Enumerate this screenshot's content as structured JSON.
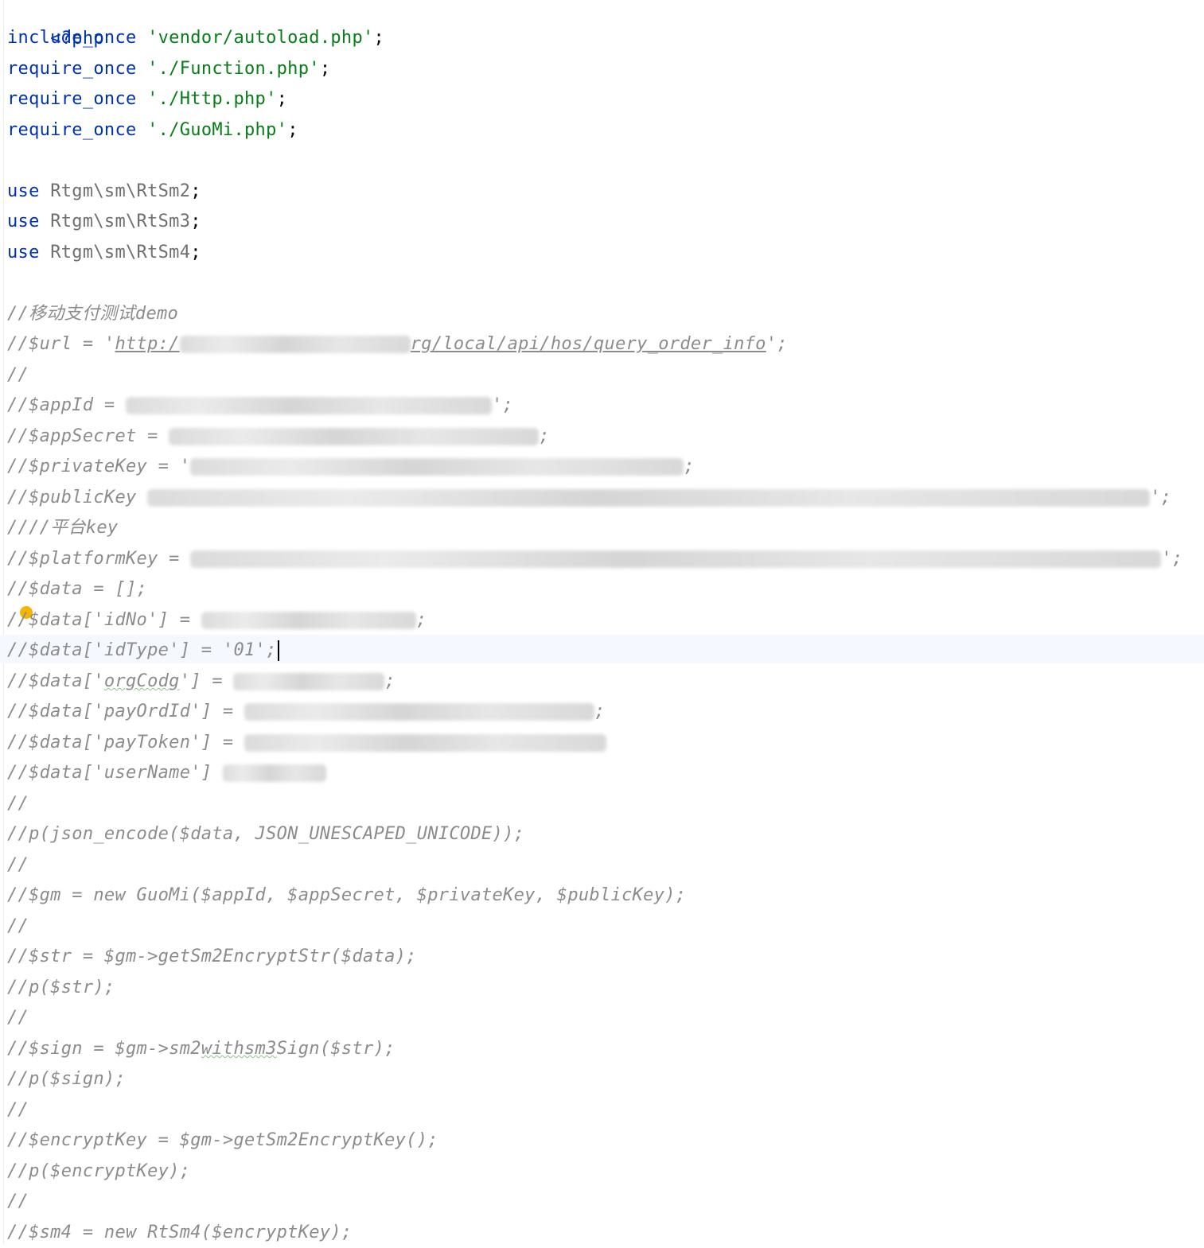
{
  "php_open": "<?php",
  "includes": [
    {
      "keyword": "include_once",
      "path": "'vendor/autoload.php'",
      "end": ";"
    },
    {
      "keyword": "require_once",
      "path": "'./Function.php'",
      "end": ";"
    },
    {
      "keyword": "require_once",
      "path": "'./Http.php'",
      "end": ";"
    },
    {
      "keyword": "require_once",
      "path": "'./GuoMi.php'",
      "end": ";"
    }
  ],
  "uses": [
    {
      "keyword": "use",
      "ns": "Rtgm\\sm\\RtSm2",
      "end": ";"
    },
    {
      "keyword": "use",
      "ns": "Rtgm\\sm\\RtSm3",
      "end": ";"
    },
    {
      "keyword": "use",
      "ns": "Rtgm\\sm\\RtSm4",
      "end": ";"
    }
  ],
  "comment_title_prefix": "//",
  "comment_title_cjk": "移动支付测试",
  "comment_title_suffix": "demo",
  "url_line": {
    "start": "//$url = '",
    "url_a": "http:/",
    "url_b": "rg/local/api/hos/query_order_info",
    "end": "';"
  },
  "lines": {
    "blank1": "//",
    "appId": "//$appId = ",
    "appId_end": "';",
    "appSecret": "//$appSecret = ",
    "appSecret_end": ";",
    "privateKey": "//$privateKey = '",
    "privateKey_end": ";",
    "publicKey": "//$publicKey ",
    "publicKey_end": "';",
    "platform_cmt_prefix": "////",
    "platform_cmt_cjk": "平台",
    "platform_cmt_suffix": "key",
    "platformKey": "//$platformKey = ",
    "platformKey_end": "';",
    "data_init": "//$data = [];",
    "idNo": "//$data['idNo'] = ",
    "idNo_end": ";",
    "idType": "//$data['idType'] = '01';",
    "orgCodg_a": "//$data['",
    "orgCodg_b": "orgCodg",
    "orgCodg_c": "'] = ",
    "orgCodg_end": ";",
    "payOrdId": "//$data['payOrdId'] = ",
    "payOrdId_end": ";",
    "payToken": "//$data['payToken'] = ",
    "userName": "//$data['userName'] ",
    "blank2": "//",
    "json": "//p(json_encode($data, JSON_UNESCAPED_UNICODE));",
    "blank3": "//",
    "gm": "//$gm = new GuoMi($appId, $appSecret, $privateKey, $publicKey);",
    "blank4": "//",
    "str": "//$str = $gm->getSm2EncryptStr($data);",
    "p_str": "//p($str);",
    "blank5": "//",
    "sign_a": "//$sign = $gm->sm2",
    "sign_b": "withsm3",
    "sign_c": "Sign($str);",
    "p_sign": "//p($sign);",
    "blank6": "//",
    "encKey": "//$encryptKey = $gm->getSm2EncryptKey();",
    "p_encKey": "//p($encryptKey);",
    "blank7": "//",
    "sm4": "//$sm4 = new RtSm4($encryptKey);"
  },
  "colors": {
    "keyword": "#0033b3",
    "string": "#067d17",
    "comment": "#8c8c8c",
    "namespace": "#6f6f6f",
    "current_line": "#f5f8fe",
    "bulb": "#f5b400"
  }
}
